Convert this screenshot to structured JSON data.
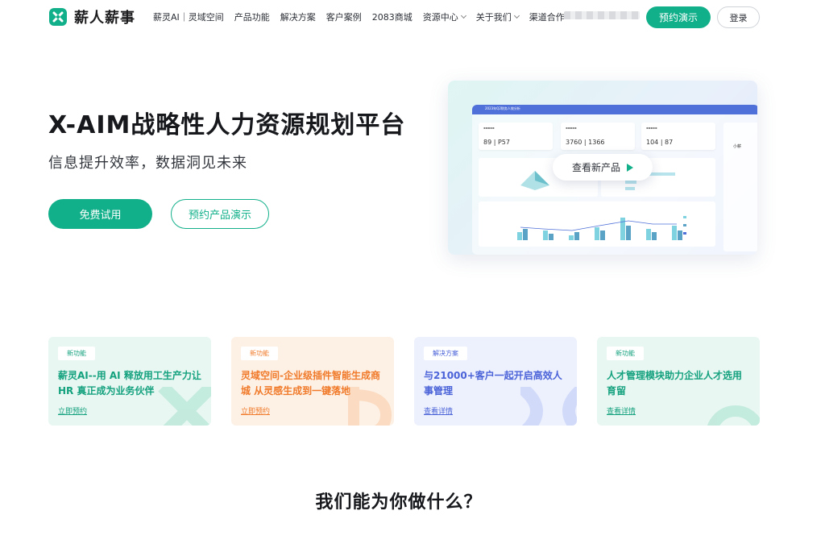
{
  "brand": {
    "name": "薪人薪事",
    "color": "#12b08a"
  },
  "nav": {
    "items": [
      {
        "label": "薪灵AI｜灵域空间",
        "dropdown": false
      },
      {
        "label": "产品功能",
        "dropdown": false
      },
      {
        "label": "解决方案",
        "dropdown": false
      },
      {
        "label": "客户案例",
        "dropdown": false
      },
      {
        "label": "2083商城",
        "dropdown": false
      },
      {
        "label": "资源中心",
        "dropdown": true
      },
      {
        "label": "关于我们",
        "dropdown": true
      },
      {
        "label": "渠道合作",
        "dropdown": false
      }
    ],
    "demo_button": "预约演示",
    "login_button": "登录"
  },
  "hero": {
    "title": "X-AIM战略性人力资源规划平台",
    "subtitle": "信息提升效率，数据洞见未来",
    "primary_button": "免费试用",
    "secondary_button": "预约产品演示"
  },
  "preview": {
    "dashboard_title": "2023年Q2财务人效分析",
    "kpis": [
      {
        "value": "89 | P57"
      },
      {
        "value": "3760 | 1366"
      },
      {
        "value": "104 | 87"
      }
    ],
    "side_name": "小薪",
    "watch_label": "查看新产品"
  },
  "cards": [
    {
      "tag": "新功能",
      "title": "薪灵AI--用 AI 释放用工生产力让 HR 真正成为业务伙伴",
      "link": "立即预约"
    },
    {
      "tag": "新功能",
      "title": "灵域空间-企业级插件智能生成商城 从灵感生成到一键落地",
      "link": "立即预约"
    },
    {
      "tag": "解决方案",
      "title": "与21000+客户一起开启高效人事管理",
      "link": "查看详情"
    },
    {
      "tag": "新功能",
      "title": "人才管理模块助力企业人才选用育留",
      "link": "查看详情"
    }
  ],
  "section": {
    "title": "我们能为你做什么？"
  },
  "chart_bars": [
    [
      10,
      14
    ],
    [
      12,
      8
    ],
    [
      6,
      10
    ],
    [
      16,
      12
    ],
    [
      28,
      18
    ],
    [
      14,
      10
    ],
    [
      18,
      12
    ]
  ]
}
